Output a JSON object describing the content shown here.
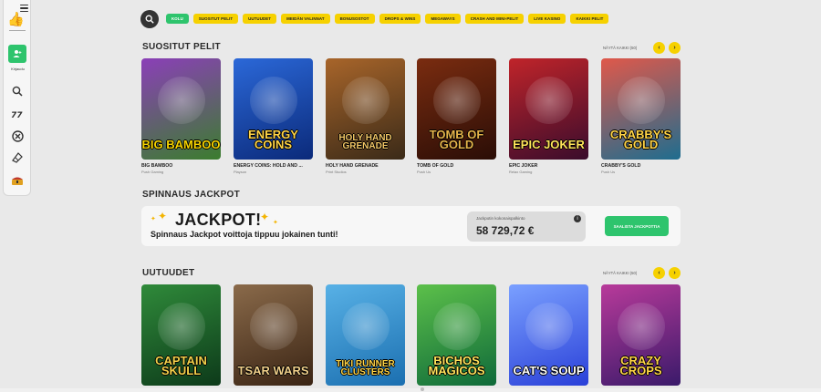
{
  "sidebar": {
    "login_label": "Kirjaudu",
    "icons": [
      "search-icon",
      "slots-icon",
      "casino-chip-icon",
      "ticket-icon",
      "chest-icon"
    ]
  },
  "tabs": [
    {
      "label": "KOLU",
      "active": true
    },
    {
      "label": "SUOSITUT PELIT",
      "active": false
    },
    {
      "label": "UUTUUDET",
      "active": false
    },
    {
      "label": "MEIDÄN VALINNAT",
      "active": false
    },
    {
      "label": "BONUSOSTOT",
      "active": false
    },
    {
      "label": "DROPS & WINS",
      "active": false
    },
    {
      "label": "MEGAWAYS",
      "active": false
    },
    {
      "label": "CRASH AND MINI-PELIT",
      "active": false
    },
    {
      "label": "LIVE KASINO",
      "active": false
    },
    {
      "label": "KAIKKI PELIT",
      "active": false
    }
  ],
  "popular": {
    "title": "SUOSITUT PELIT",
    "show_all": "NÄYTÄ KAIKKI (50)",
    "games": [
      {
        "name": "BIG BAMBOO",
        "provider": "Push Gaming",
        "art": "BIG BAMBOO",
        "bg1": "#3b7d2e",
        "bg2": "#8b3fb8",
        "fg": "#f5d300"
      },
      {
        "name": "ENERGY COINS: HOLD AND ...",
        "provider": "Playson",
        "art": "ENERGY COINS",
        "bg1": "#0b2a7a",
        "bg2": "#2b68d8",
        "fg": "#ffd447"
      },
      {
        "name": "HOLY HAND GRENADE",
        "provider": "Print Studios",
        "art": "HOLY HAND GRENADE",
        "bg1": "#3a2a18",
        "bg2": "#a8652a",
        "fg": "#f3c766"
      },
      {
        "name": "TOMB OF GOLD",
        "provider": "Push Us",
        "art": "TOMB OF GOLD",
        "bg1": "#2a0d06",
        "bg2": "#7a2c10",
        "fg": "#e5b34a"
      },
      {
        "name": "EPIC JOKER",
        "provider": "Relax Gaming",
        "art": "EPIC JOKER",
        "bg1": "#3a0c2c",
        "bg2": "#c0242a",
        "fg": "#ffe35a"
      },
      {
        "name": "CRABBY'S GOLD",
        "provider": "Push Us",
        "art": "CRABBY'S GOLD",
        "bg1": "#1e6d8f",
        "bg2": "#e0584a",
        "fg": "#ffd447"
      }
    ]
  },
  "jackpot": {
    "section_title": "SPINNAUS JACKPOT",
    "title": "JACKPOT!",
    "subtitle": "Spinnaus Jackpot voittoja tippuu jokainen tunti!",
    "box_label": "Jackpotin kokonaispalkinto",
    "amount": "58 729,72 €",
    "info": "i",
    "button": "SAALISTA JACKPOTTIA"
  },
  "new": {
    "title": "UUTUUDET",
    "show_all": "NÄYTÄ KAIKKI (50)",
    "games": [
      {
        "art": "CAPTAIN SKULL",
        "bg1": "#0d3a1a",
        "bg2": "#2f8a3a",
        "fg": "#f2d04a"
      },
      {
        "art": "TSAR WARS",
        "bg1": "#3a2414",
        "bg2": "#8a6a4a",
        "fg": "#f0cf8a"
      },
      {
        "art": "TIKI RUNNER CLUSTERS",
        "bg1": "#1b6fb0",
        "bg2": "#58b1e6",
        "fg": "#ffd447"
      },
      {
        "art": "BICHOS MAGICOS",
        "bg1": "#0f6a3a",
        "bg2": "#5cc04a",
        "fg": "#ffe35a"
      },
      {
        "art": "CAT'S SOUP",
        "bg1": "#2a40d8",
        "bg2": "#7aa0ff",
        "fg": "#ffffff"
      },
      {
        "art": "CRAZY CROPS",
        "bg1": "#3a1a6a",
        "bg2": "#b83a9a",
        "fg": "#ffd447"
      }
    ]
  },
  "colors": {
    "accent_green": "#2ec46d",
    "accent_yellow": "#f6d100"
  }
}
